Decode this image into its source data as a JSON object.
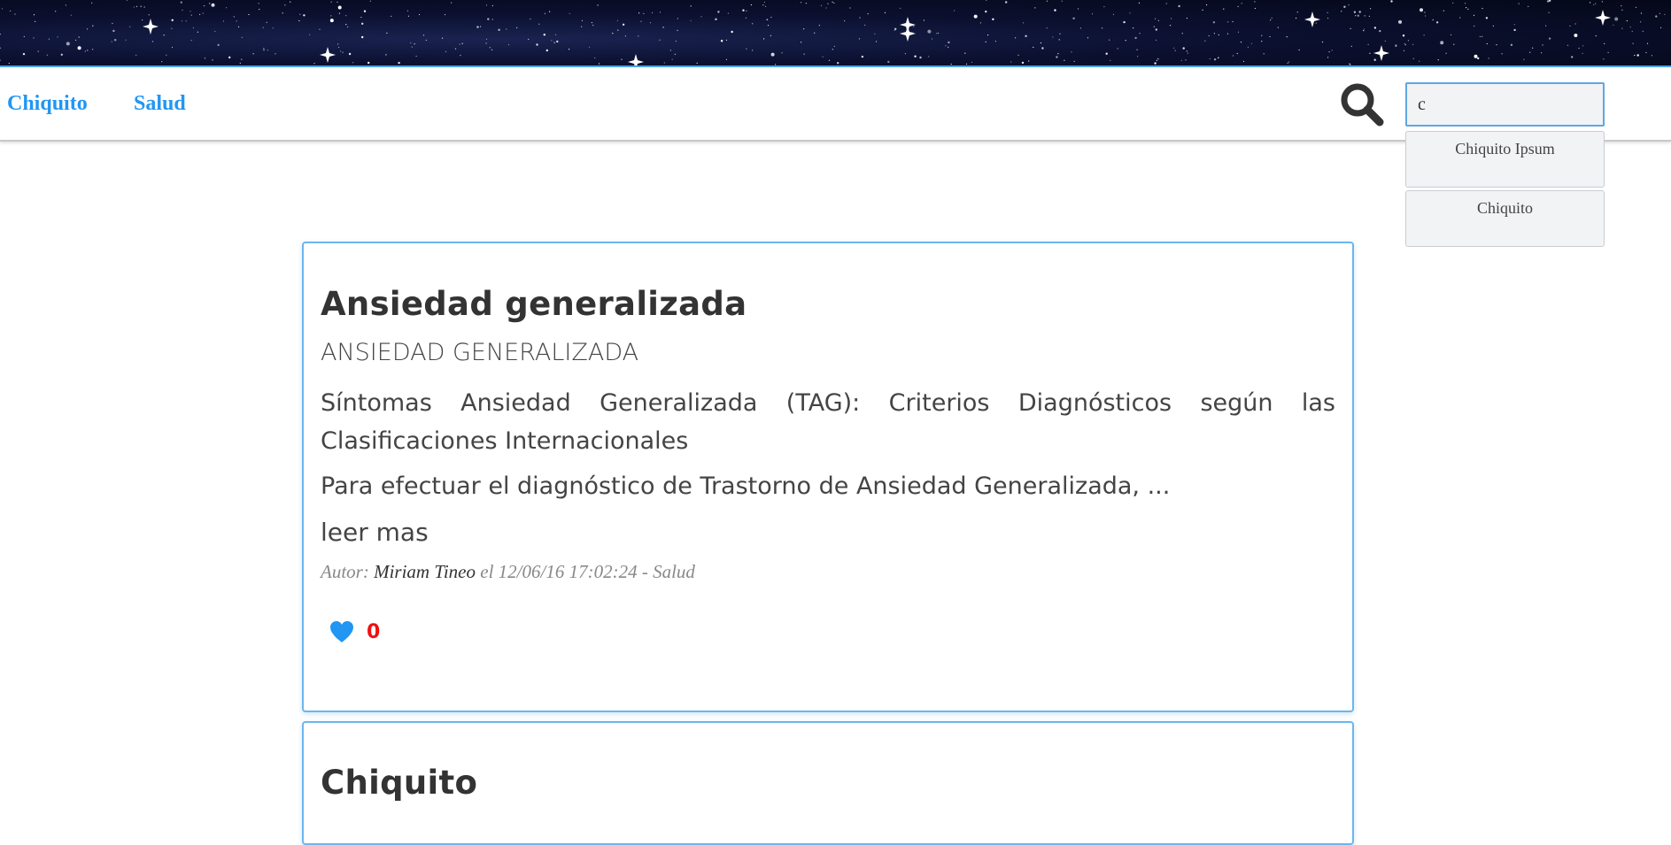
{
  "nav": {
    "links": [
      "Chiquito",
      "Salud"
    ]
  },
  "search": {
    "value": "c",
    "suggestions": [
      "Chiquito Ipsum",
      "Chiquito"
    ]
  },
  "posts": [
    {
      "title": "Ansiedad generalizada",
      "subtitle": "ANSIEDAD GENERALIZADA",
      "heading": "Síntomas Ansiedad Generalizada (TAG): Criterios Diagnósticos según las Clasificaciones Internacionales",
      "excerpt": "Para efectuar el diagnóstico de Trastorno de Ansiedad Generalizada, ...",
      "read_more": "leer mas",
      "meta_prefix": "Autor:",
      "author": "Miriam Tineo",
      "meta_suffix": "el 12/06/16 17:02:24 - Salud",
      "likes": "0"
    },
    {
      "title": "Chiquito"
    }
  ],
  "colors": {
    "accent": "#2196f3",
    "card_border": "#6bb6ee",
    "like_count": "#ee1111"
  },
  "icons": {
    "search": "search-icon",
    "like": "heart-icon"
  }
}
